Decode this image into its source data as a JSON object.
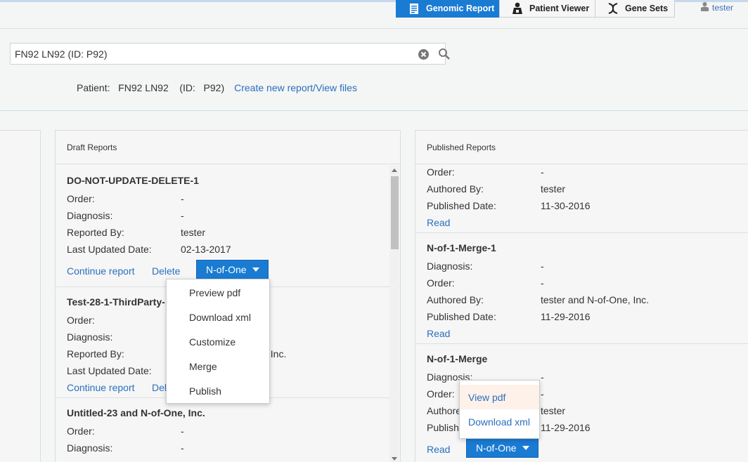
{
  "nav": {
    "tabs": [
      {
        "label": "Genomic Report",
        "icon": "document-icon",
        "active": true
      },
      {
        "label": "Patient Viewer",
        "icon": "patient-icon",
        "active": false
      },
      {
        "label": "Gene Sets",
        "icon": "dna-icon",
        "active": false
      }
    ],
    "user": "tester"
  },
  "search": {
    "value": "FN92 LN92 (ID: P92)"
  },
  "patient": {
    "label": "Patient:",
    "name": "FN92 LN92",
    "id_label": "(ID:",
    "id_value": "P92)",
    "create_link": "Create new report/View files"
  },
  "draft": {
    "title": "Draft Reports",
    "reports": [
      {
        "name": "DO-NOT-UPDATE-DELETE-1",
        "order_label": "Order:",
        "order": "-",
        "diagnosis_label": "Diagnosis:",
        "diagnosis": "-",
        "reported_label": "Reported By:",
        "reported": "tester",
        "updated_label": "Last Updated Date:",
        "updated": "02-13-2017",
        "continue": "Continue report",
        "delete": "Delete",
        "action": "N-of-One"
      },
      {
        "name": "Test-28-1-ThirdParty-",
        "order_label": "Order:",
        "diagnosis_label": "Diagnosis:",
        "reported_label": "Reported By:",
        "reported_partial": ", Inc.",
        "updated_label": "Last Updated Date:",
        "continue": "Continue report",
        "delete": "Del"
      },
      {
        "name": "Untitled-23 and N-of-One, Inc.",
        "order_label": "Order:",
        "order": "-",
        "diagnosis_label": "Diagnosis:",
        "diagnosis": "-"
      }
    ],
    "menu": [
      "Preview pdf",
      "Download xml",
      "Customize",
      "Merge",
      "Publish"
    ]
  },
  "published": {
    "title": "Published Reports",
    "reports": [
      {
        "order_label": "Order:",
        "order": "-",
        "authored_label": "Authored By:",
        "authored": "tester",
        "published_label": "Published Date:",
        "published": "11-30-2016",
        "read": "Read"
      },
      {
        "name": "N-of-1-Merge-1",
        "diagnosis_label": "Diagnosis:",
        "diagnosis": "-",
        "order_label": "Order:",
        "order": "-",
        "authored_label": "Authored By:",
        "authored": "tester and N-of-One, Inc.",
        "published_label": "Published Date:",
        "published": "11-29-2016",
        "read": "Read"
      },
      {
        "name": "N-of-1-Merge",
        "diagnosis_label": "Diagnosis:",
        "diagnosis": "-",
        "order_label": "Order:",
        "order": "-",
        "authored_label": "Authore",
        "authored": "tester",
        "published_label": "Publish",
        "published": "11-29-2016",
        "read": "Read",
        "action": "N-of-One"
      }
    ],
    "menu": [
      "View pdf",
      "Download xml"
    ]
  },
  "colors": {
    "accent": "#1a7bd3",
    "link": "#2a6fc0",
    "menu_highlight": "#fdf1ea"
  }
}
